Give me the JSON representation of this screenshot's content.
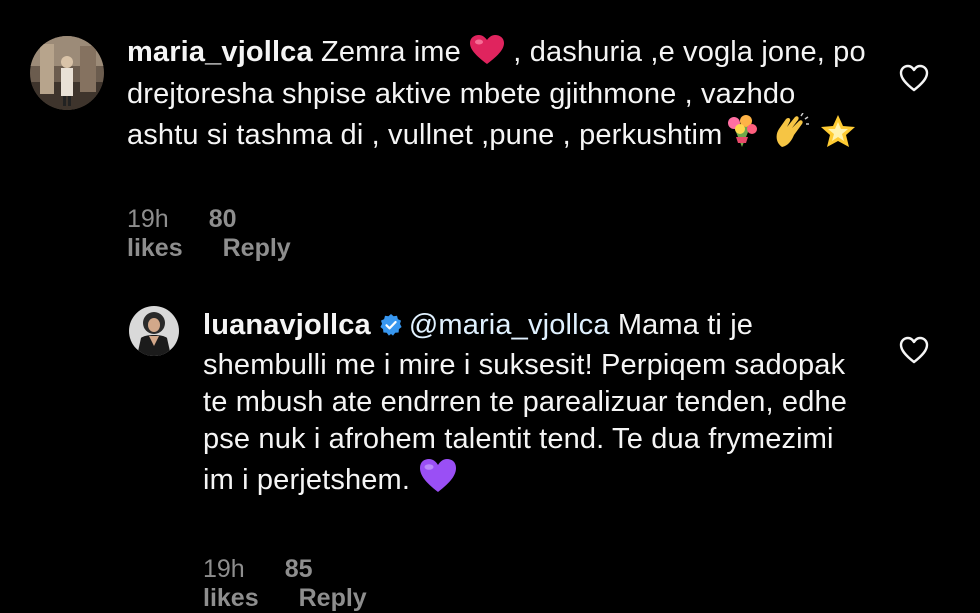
{
  "comments": [
    {
      "username": "maria_vjollca",
      "text_part1": " Zemra ime ",
      "text_part2": " , dashuria ,e vogla jone, po drejtoresha shpise aktive mbete gjithmone , vazhdo ashtu si tashma di , vullnet ,pune , perkushtim",
      "time": "19h",
      "likes": "80 likes",
      "reply": "Reply",
      "emojis": [
        "red-heart",
        "bouquet",
        "clapping-hands",
        "glowing-star"
      ]
    },
    {
      "username": "luanavjollca",
      "verified": true,
      "mention": "@maria_vjollca",
      "text": " Mama ti je shembulli me i mire i suksesit! Perpiqem sadopak te mbush ate endrren te parealizuar tenden, edhe pse nuk i afrohem talentit tend. Te dua frymezimi im i perjetshem. ",
      "time": "19h",
      "likes": "85 likes",
      "reply": "Reply",
      "emojis": [
        "purple-heart"
      ]
    }
  ],
  "colors": {
    "background": "#000000",
    "text": "#f5f5f5",
    "meta": "#8e8e8e",
    "verified": "#3897f0",
    "red_heart": "#e0245e",
    "purple_heart": "#9a4ff5"
  }
}
